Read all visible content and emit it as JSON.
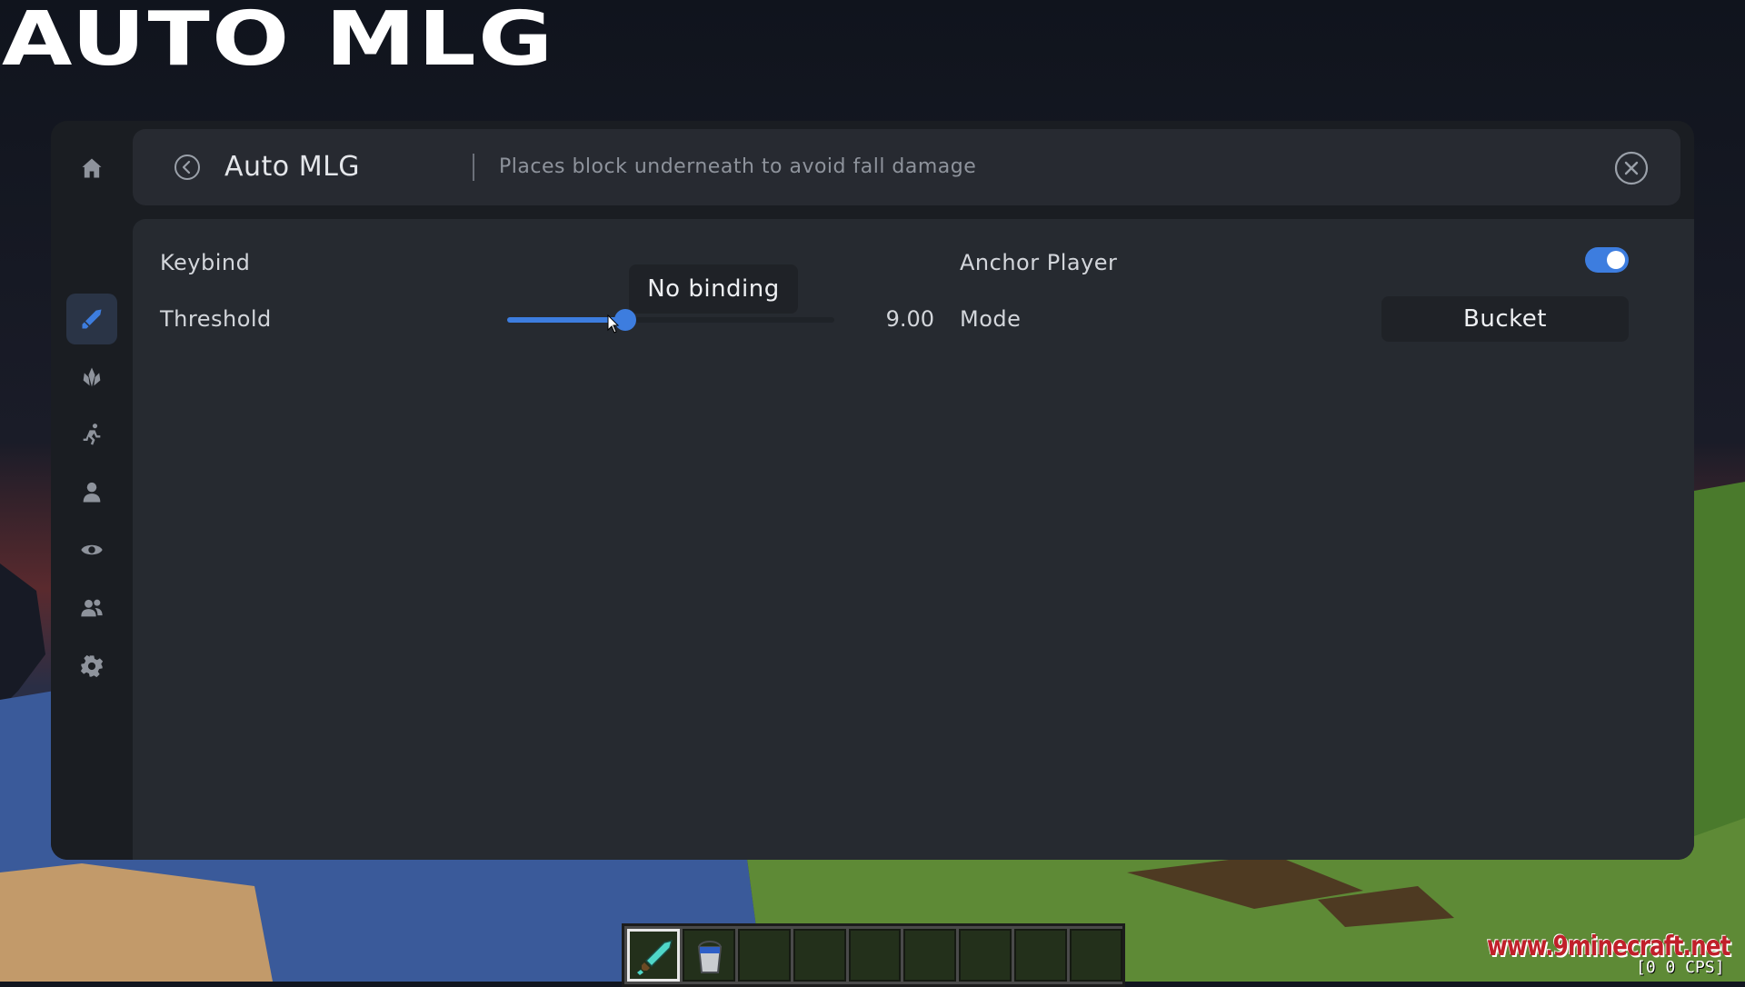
{
  "overlay_title": "AUTO MLG",
  "header": {
    "title": "Auto MLG",
    "description": "Places block underneath to avoid fall damage"
  },
  "settings": {
    "keybind": {
      "label": "Keybind",
      "value": "No binding"
    },
    "threshold": {
      "label": "Threshold",
      "value_text": "9.00",
      "fraction": 0.36
    },
    "anchor_player": {
      "label": "Anchor Player",
      "enabled": true
    },
    "mode": {
      "label": "Mode",
      "value": "Bucket"
    }
  },
  "sidebar": {
    "items": [
      {
        "icon": "home-icon",
        "active": false
      },
      {
        "icon": "sword-icon",
        "active": true
      },
      {
        "icon": "crystal-icon",
        "active": false
      },
      {
        "icon": "running-icon",
        "active": false
      },
      {
        "icon": "user-icon",
        "active": false
      },
      {
        "icon": "eye-icon",
        "active": false
      },
      {
        "icon": "users-icon",
        "active": false
      },
      {
        "icon": "gear-icon",
        "active": false
      }
    ]
  },
  "hotbar": {
    "selected_slot": 0,
    "items": [
      "diamond-sword-icon",
      "water-bucket-icon",
      "",
      "",
      "",
      "",
      "",
      "",
      ""
    ]
  },
  "watermark": "www.9minecraft.net",
  "fps_text": "[0 0 CPS]",
  "colors": {
    "accent": "#3d7ddf",
    "panel": "#1a1d22",
    "content": "#262a30"
  }
}
